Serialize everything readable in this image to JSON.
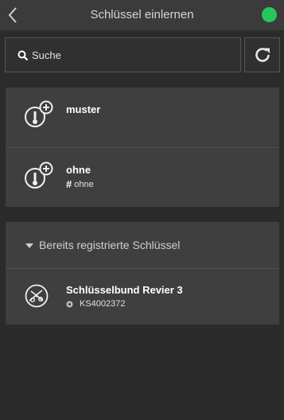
{
  "header": {
    "title": "Schlüssel einlernen",
    "back_icon": "chevron-left-icon",
    "status_color": "#28c65a"
  },
  "search": {
    "placeholder": "Suche",
    "icon": "search-icon"
  },
  "refresh": {
    "icon": "refresh-icon"
  },
  "keys": [
    {
      "name": "muster",
      "icon": "key-add-icon"
    },
    {
      "name": "ohne",
      "icon": "key-add-icon",
      "sub_label": "ohne"
    }
  ],
  "registered": {
    "header_label": "Bereits registrierte Schlüssel",
    "items": [
      {
        "name": "Schlüsselbund Revier 3",
        "id": "KS4002372",
        "icon": "keyring-icon"
      }
    ]
  }
}
